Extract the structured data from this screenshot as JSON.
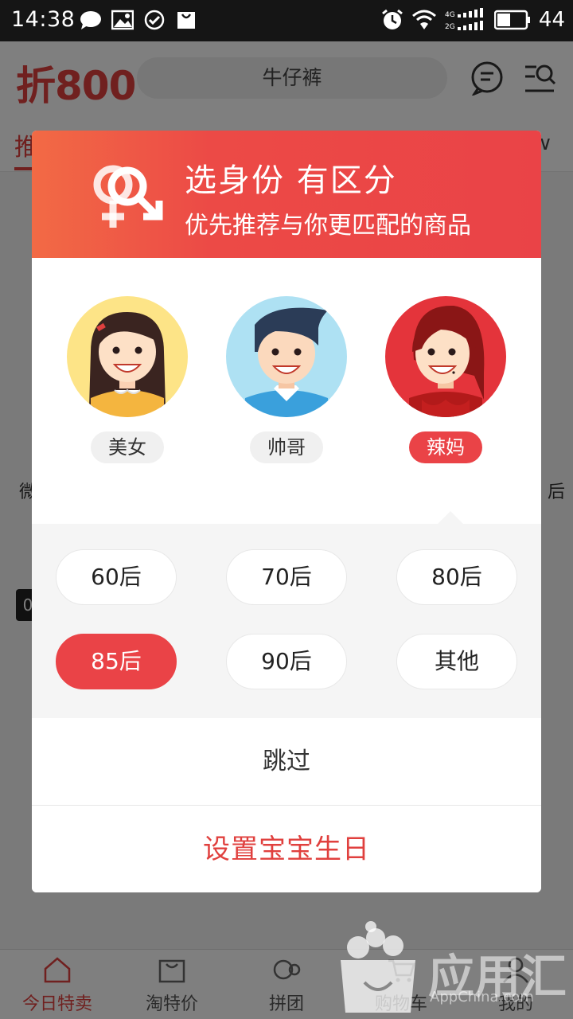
{
  "status_bar": {
    "time": "14:38",
    "battery_level": "44",
    "left_icons": [
      "chat-bubble-icon",
      "image-icon",
      "check-circle-icon",
      "shopping-bag-icon"
    ],
    "right_icons": [
      "alarm-icon",
      "wifi-icon",
      "signal-4g-icon",
      "signal-2g-icon",
      "battery-icon"
    ]
  },
  "header": {
    "logo": "折800",
    "search_placeholder": "牛仔裤",
    "icons": [
      "message-icon",
      "search-menu-icon"
    ]
  },
  "tabs": {
    "first_tab": "推"
  },
  "background": {
    "left_label": "微",
    "right_label": "后",
    "badge": "0"
  },
  "dialog": {
    "title": "选身份  有区分",
    "subtitle": "优先推荐与你更匹配的商品",
    "identities": [
      {
        "label": "美女",
        "selected": false
      },
      {
        "label": "帅哥",
        "selected": false
      },
      {
        "label": "辣妈",
        "selected": true
      }
    ],
    "ages": [
      {
        "label": "60后",
        "selected": false
      },
      {
        "label": "70后",
        "selected": false
      },
      {
        "label": "80后",
        "selected": false
      },
      {
        "label": "85后",
        "selected": true
      },
      {
        "label": "90后",
        "selected": false
      },
      {
        "label": "其他",
        "selected": false
      }
    ],
    "skip_label": "跳过",
    "birthday_label": "设置宝宝生日"
  },
  "bottom_nav": [
    {
      "label": "今日特卖",
      "icon": "home-icon",
      "active": true
    },
    {
      "label": "淘特价",
      "icon": "shopping-bag-icon",
      "active": false
    },
    {
      "label": "拼团",
      "icon": "group-icon",
      "active": false
    },
    {
      "label": "购物车",
      "icon": "cart-icon",
      "active": false
    },
    {
      "label": "我的",
      "icon": "profile-icon",
      "active": false
    }
  ],
  "watermark": {
    "text": "应用汇",
    "sub": "AppChina.com"
  },
  "colors": {
    "brand_red": "#ea4347",
    "header_gradient_start": "#f26a45",
    "overlay": "rgba(0,0,0,0.5)"
  }
}
